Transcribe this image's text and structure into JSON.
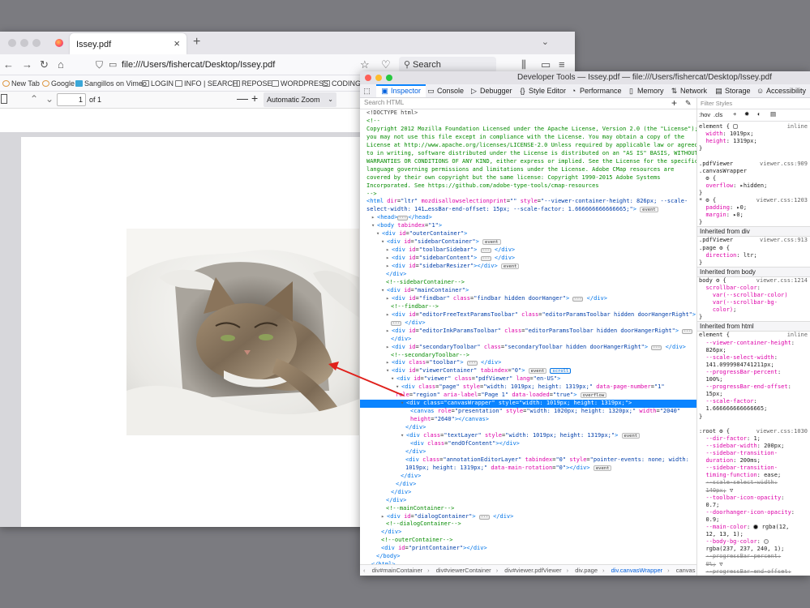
{
  "browser": {
    "tab_title": "Issey.pdf",
    "tab_close": "×",
    "new_tab": "+",
    "tab_menu": "⌄",
    "url": "file:///Users/fishercat/Desktop/Issey.pdf",
    "search_placeholder": "Search",
    "bookmarks": [
      "New Tab",
      "Google",
      "Sangillos on Vimeo",
      "LOGIN",
      "INFO | SEARCH",
      "REPOSE",
      "WORDPRESS",
      "CODING"
    ],
    "nav_icons": [
      "back-icon",
      "forward-icon",
      "reload-icon",
      "home-icon",
      "shield-icon",
      "star-icon",
      "pocket-icon",
      "library-icon",
      "reader-icon",
      "menu-icon"
    ]
  },
  "pdf_toolbar": {
    "page_value": "1",
    "of_label": "of 1",
    "zoom_label": "Automatic Zoom",
    "minus": "—",
    "plus": "+"
  },
  "devtools": {
    "title": "Developer Tools — Issey.pdf — file:///Users/fishercat/Desktop/Issey.pdf",
    "tabs": [
      "Inspector",
      "Console",
      "Debugger",
      "Style Editor",
      "Performance",
      "Memory",
      "Network",
      "Storage",
      "Accessibility"
    ],
    "active_tab": "Inspector",
    "search_placeholder": "Search HTML",
    "filter_placeholder": "Filter Styles",
    "rule_tools": [
      ":hov",
      ".cls",
      "+"
    ],
    "breadcrumbs": [
      "div#mainContainer",
      "div#viewerContainer",
      "div#viewer.pdfViewer",
      "div.page",
      "div.canvasWrapper",
      "canvas"
    ],
    "html_lines": [
      {
        "i": 0,
        "h": "<span class='p'>&lt;!DOCTYPE html&gt;</span>"
      },
      {
        "i": 0,
        "h": "<span class='c'>&lt;!--</span>"
      },
      {
        "i": 0,
        "h": "<span class='c'>Copyright 2012 Mozilla Foundation Licensed under the Apache License, Version 2.0 (the \"License\");</span>"
      },
      {
        "i": 0,
        "h": "<span class='c'>you may not use this file except in compliance with the License. You may obtain a copy of the</span>"
      },
      {
        "i": 0,
        "h": "<span class='c'>License at http://www.apache.org/licenses/LICENSE-2.0 Unless required by applicable law or agreed</span>"
      },
      {
        "i": 0,
        "h": "<span class='c'>to in writing, software distributed under the License is distributed on an \"AS IS\" BASIS, WITHOUT</span>"
      },
      {
        "i": 0,
        "h": "<span class='c'>WARRANTIES OR CONDITIONS OF ANY KIND, either express or implied. See the License for the specific</span>"
      },
      {
        "i": 0,
        "h": "<span class='c'>language governing permissions and limitations under the License. Adobe CMap resources are</span>"
      },
      {
        "i": 0,
        "h": "<span class='c'>covered by their own copyright but the same license: Copyright 1990-2015 Adobe Systems</span>"
      },
      {
        "i": 0,
        "h": "<span class='c'>Incorporated. See https://github.com/adobe-type-tools/cmap-resources</span>"
      },
      {
        "i": 0,
        "h": "<span class='c'>--&gt;</span>"
      },
      {
        "i": 0,
        "h": "<span class='t'>&lt;html</span> <span class='a'>dir</span>=<span class='v'>\"ltr\"</span> <span class='a'>mozdisallowselectionprint</span>=<span class='v'>\"\"</span> <span class='a'>style</span>=<span class='v'>\"--viewer-container-height: 826px; --scale-</span>"
      },
      {
        "i": 0,
        "h": "<span class='v'>select-width: 141…essBar-end-offset: 15px; --scale-factor: 1.666666666666665;\"</span><span class='t'>&gt;</span> <span class='badge'>event</span>"
      },
      {
        "i": 1,
        "h": "<span class='tw'>▸</span><span class='t'>&lt;head&gt;</span><span class='dots'>···</span><span class='t'>&lt;/head&gt;</span>"
      },
      {
        "i": 1,
        "h": "<span class='tw'>▾</span><span class='t'>&lt;body</span> <span class='a'>tabindex</span>=<span class='v'>\"1\"</span><span class='t'>&gt;</span>"
      },
      {
        "i": 2,
        "h": "<span class='tw'>▾</span><span class='t'>&lt;div</span> <span class='a'>id</span>=<span class='v'>\"outerContainer\"</span><span class='t'>&gt;</span>"
      },
      {
        "i": 3,
        "h": "<span class='tw'>▾</span><span class='t'>&lt;div</span> <span class='a'>id</span>=<span class='v'>\"sidebarContainer\"</span><span class='t'>&gt;</span> <span class='badge'>event</span>"
      },
      {
        "i": 4,
        "h": "<span class='tw'>▸</span><span class='t'>&lt;div</span> <span class='a'>id</span>=<span class='v'>\"toolbarSidebar\"</span><span class='t'>&gt;</span> <span class='dots'>···</span> <span class='t'>&lt;/div&gt;</span>"
      },
      {
        "i": 4,
        "h": "<span class='tw'>▸</span><span class='t'>&lt;div</span> <span class='a'>id</span>=<span class='v'>\"sidebarContent\"</span><span class='t'>&gt;</span> <span class='dots'>···</span> <span class='t'>&lt;/div&gt;</span>"
      },
      {
        "i": 4,
        "h": "<span class='tw'>▸</span><span class='t'>&lt;div</span> <span class='a'>id</span>=<span class='v'>\"sidebarResizer\"</span><span class='t'>&gt;&lt;/div&gt;</span> <span class='badge'>event</span>"
      },
      {
        "i": 4,
        "h": "<span class='t'>&lt;/div&gt;</span>"
      },
      {
        "i": 4,
        "h": "<span class='c'>&lt;!--sidebarContainer--&gt;</span>"
      },
      {
        "i": 3,
        "h": "<span class='tw'>▾</span><span class='t'>&lt;div</span> <span class='a'>id</span>=<span class='v'>\"mainContainer\"</span><span class='t'>&gt;</span>"
      },
      {
        "i": 4,
        "h": "<span class='tw'>▸</span><span class='t'>&lt;div</span> <span class='a'>id</span>=<span class='v'>\"findbar\"</span> <span class='a'>class</span>=<span class='v'>\"findbar hidden doorHanger\"</span><span class='t'>&gt;</span> <span class='dots'>···</span> <span class='t'>&lt;/div&gt;</span>"
      },
      {
        "i": 5,
        "h": "<span class='c'>&lt;!--findbar--&gt;</span>"
      },
      {
        "i": 4,
        "h": "<span class='tw'>▸</span><span class='t'>&lt;div</span> <span class='a'>id</span>=<span class='v'>\"editorFreeTextParamsToolbar\"</span> <span class='a'>class</span>=<span class='v'>\"editorParamsToolbar hidden doorHangerRight\"</span><span class='t'>&gt;</span>"
      },
      {
        "i": 5,
        "h": "<span class='dots'>···</span> <span class='t'>&lt;/div&gt;</span>"
      },
      {
        "i": 4,
        "h": "<span class='tw'>▸</span><span class='t'>&lt;div</span> <span class='a'>id</span>=<span class='v'>\"editorInkParamsToolbar\"</span> <span class='a'>class</span>=<span class='v'>\"editorParamsToolbar hidden doorHangerRight\"</span><span class='t'>&gt;</span> <span class='dots'>···</span>"
      },
      {
        "i": 5,
        "h": "<span class='t'>&lt;/div&gt;</span>"
      },
      {
        "i": 4,
        "h": "<span class='tw'>▸</span><span class='t'>&lt;div</span> <span class='a'>id</span>=<span class='v'>\"secondaryToolbar\"</span> <span class='a'>class</span>=<span class='v'>\"secondaryToolbar hidden doorHangerRight\"</span><span class='t'>&gt;</span> <span class='dots'>···</span> <span class='t'>&lt;/div&gt;</span>"
      },
      {
        "i": 5,
        "h": "<span class='c'>&lt;!--secondaryToolbar--&gt;</span>"
      },
      {
        "i": 4,
        "h": "<span class='tw'>▸</span><span class='t'>&lt;div</span> <span class='a'>class</span>=<span class='v'>\"toolbar\"</span><span class='t'>&gt;</span> <span class='dots'>···</span> <span class='t'>&lt;/div&gt;</span>"
      },
      {
        "i": 4,
        "h": "<span class='tw'>▾</span><span class='t'>&lt;div</span> <span class='a'>id</span>=<span class='v'>\"viewerContainer\"</span> <span class='a'>tabindex</span>=<span class='v'>\"0\"</span><span class='t'>&gt;</span> <span class='badge'>event</span> <span class='badge hl'>scroll</span>"
      },
      {
        "i": 5,
        "h": "<span class='tw'>▾</span><span class='t'>&lt;div</span> <span class='a'>id</span>=<span class='v'>\"viewer\"</span> <span class='a'>class</span>=<span class='v'>\"pdfViewer\"</span> <span class='a'>lang</span>=<span class='v'>\"en-US\"</span><span class='t'>&gt;</span>"
      },
      {
        "i": 6,
        "h": "<span class='tw'>▾</span><span class='t'>&lt;div</span> <span class='a'>class</span>=<span class='v'>\"page\"</span> <span class='a'>style</span>=<span class='v'>\"width: 1019px; height: 1319px;\"</span> <span class='a'>data-page-number</span>=<span class='v'>\"1\"</span>"
      },
      {
        "i": 6,
        "h": "<span class='a'>role</span>=<span class='v'>\"region\"</span> <span class='a'>aria-label</span>=<span class='v'>\"Page 1\"</span> <span class='a'>data-loaded</span>=<span class='v'>\"true\"</span><span class='t'>&gt;</span> <span class='badge'>overflow</span>"
      },
      {
        "i": 7,
        "sel": true,
        "h": "<span class='tw'>▾</span><span class='t'>&lt;div</span> <span class='a'>class</span>=<span class='v'>\"canvasWrapper\"</span> <span class='a'>style</span>=<span class='v'>\"width: 1019px; height: 1319px;\"</span><span class='t'>&gt;</span>"
      },
      {
        "i": 9,
        "h": "<span class='t'>&lt;canvas</span> <span class='a'>role</span>=<span class='v'>\"presentation\"</span> <span class='a'>style</span>=<span class='v'>\"width: 1020px; height: 1320px;\"</span> <span class='a'>width</span>=<span class='v'>\"2040\"</span>"
      },
      {
        "i": 9,
        "h": "<span class='a'>height</span>=<span class='v'>\"2640\"</span><span class='t'>&gt;&lt;/canvas&gt;</span>"
      },
      {
        "i": 8,
        "h": "<span class='t'>&lt;/div&gt;</span>"
      },
      {
        "i": 7,
        "h": "<span class='tw'>▾</span><span class='t'>&lt;div</span> <span class='a'>class</span>=<span class='v'>\"textLayer\"</span> <span class='a'>style</span>=<span class='v'>\"width: 1019px; height: 1319px;\"</span><span class='t'>&gt;</span> <span class='badge'>event</span>"
      },
      {
        "i": 9,
        "h": "<span class='t'>&lt;div</span> <span class='a'>class</span>=<span class='v'>\"endOfContent\"</span><span class='t'>&gt;&lt;/div&gt;</span>"
      },
      {
        "i": 8,
        "h": "<span class='t'>&lt;/div&gt;</span>"
      },
      {
        "i": 8,
        "h": "<span class='t'>&lt;div</span> <span class='a'>class</span>=<span class='v'>\"annotationEditorLayer\"</span> <span class='a'>tabindex</span>=<span class='v'>\"0\"</span> <span class='a'>style</span>=<span class='v'>\"pointer-events: none; width:</span>"
      },
      {
        "i": 8,
        "h": "<span class='v'>1019px; height: 1319px;\"</span> <span class='a'>data-main-rotation</span>=<span class='v'>\"0\"</span><span class='t'>&gt;&lt;/div&gt;</span> <span class='badge'>event</span>"
      },
      {
        "i": 7,
        "h": "<span class='t'>&lt;/div&gt;</span>"
      },
      {
        "i": 6,
        "h": "<span class='t'>&lt;/div&gt;</span>"
      },
      {
        "i": 5,
        "h": "<span class='t'>&lt;/div&gt;</span>"
      },
      {
        "i": 4,
        "h": "<span class='t'>&lt;/div&gt;</span>"
      },
      {
        "i": 4,
        "h": "<span class='c'>&lt;!--mainContainer--&gt;</span>"
      },
      {
        "i": 3,
        "h": "<span class='tw'>▸</span><span class='t'>&lt;div</span> <span class='a'>id</span>=<span class='v'>\"dialogContainer\"</span><span class='t'>&gt;</span> <span class='dots'>···</span> <span class='t'>&lt;/div&gt;</span>"
      },
      {
        "i": 4,
        "h": "<span class='c'>&lt;!--dialogContainer--&gt;</span>"
      },
      {
        "i": 3,
        "h": "<span class='t'>&lt;/div&gt;</span>"
      },
      {
        "i": 3,
        "h": "<span class='c'>&lt;!--outerContainer--&gt;</span>"
      },
      {
        "i": 3,
        "h": "<span class='t'>&lt;div</span> <span class='a'>id</span>=<span class='v'>\"printContainer\"</span><span class='t'>&gt;&lt;/div&gt;</span>"
      },
      {
        "i": 2,
        "h": "<span class='t'>&lt;/body&gt;</span>"
      },
      {
        "i": 1,
        "h": "<span class='t'>&lt;/html&gt;</span>"
      }
    ],
    "rule_lines": [
      {
        "k": "r",
        "h": "<span class='sel-txt'>element { </span><span class='swatch' style='border-radius:2px'></span><span class='src'>inline</span>"
      },
      {
        "k": "r",
        "h": "&nbsp;&nbsp;<span class='prop'>width</span>: <span class='val'>1019px;</span>"
      },
      {
        "k": "r",
        "h": "&nbsp;&nbsp;<span class='prop'>height</span>: <span class='val'>1319px;</span>"
      },
      {
        "k": "r",
        "h": "}"
      },
      {
        "k": "r",
        "h": ""
      },
      {
        "k": "r",
        "h": "<span class='sel-txt'>.pdfViewer</span><span class='src'>viewer.css:909</span>"
      },
      {
        "k": "r",
        "h": "<span class='sel-txt'>.canvasWrapper</span>"
      },
      {
        "k": "r",
        "h": "&nbsp;&nbsp;⚙ {"
      },
      {
        "k": "r",
        "h": "&nbsp;&nbsp;<span class='prop'>overflow</span>: ▸<span class='val'>hidden;</span>"
      },
      {
        "k": "r",
        "h": "}"
      },
      {
        "k": "r",
        "h": "<span class='sel-txt'>* ⚙ {</span><span class='src'>viewer.css:1203</span>"
      },
      {
        "k": "r",
        "h": "&nbsp;&nbsp;<span class='prop'>padding</span>: ▸<span class='val'>0;</span>"
      },
      {
        "k": "r",
        "h": "&nbsp;&nbsp;<span class='prop'>margin</span>: ▸<span class='val'>0;</span>"
      },
      {
        "k": "r",
        "h": "}"
      },
      {
        "k": "h",
        "h": "Inherited from div"
      },
      {
        "k": "r",
        "h": "<span class='sel-txt'>.pdfViewer</span><span class='src'>viewer.css:913</span>"
      },
      {
        "k": "r",
        "h": "<span class='sel-txt'>.page ⚙ {</span>"
      },
      {
        "k": "r",
        "h": "&nbsp;&nbsp;<span class='prop'>direction</span>: <span class='val'>ltr;</span>"
      },
      {
        "k": "r",
        "h": "}"
      },
      {
        "k": "h",
        "h": "Inherited from body"
      },
      {
        "k": "r",
        "h": "<span class='sel-txt'>body ⚙ {</span><span class='src'>viewer.css:1214</span>"
      },
      {
        "k": "r",
        "h": "&nbsp;&nbsp;<span class='prop'>scrollbar-color</span>:"
      },
      {
        "k": "r",
        "h": "&nbsp;&nbsp;&nbsp;&nbsp;<span class='prop'>var(--scrollbar-color)</span>"
      },
      {
        "k": "r",
        "h": "&nbsp;&nbsp;&nbsp;&nbsp;<span class='prop'>var(--scrollbar-bg-</span>"
      },
      {
        "k": "r",
        "h": "&nbsp;&nbsp;&nbsp;&nbsp;<span class='prop'>color)</span>;"
      },
      {
        "k": "r",
        "h": "}"
      },
      {
        "k": "h",
        "h": "Inherited from html"
      },
      {
        "k": "r",
        "h": "<span class='sel-txt'>element {</span><span class='src'>inline</span>"
      },
      {
        "k": "r",
        "h": "&nbsp;&nbsp;<span class='prop'>--viewer-container-height</span>:"
      },
      {
        "k": "r",
        "h": "&nbsp;&nbsp;<span class='val'>826px;</span>"
      },
      {
        "k": "r",
        "h": "&nbsp;&nbsp;<span class='prop'>--scale-select-width</span>:"
      },
      {
        "k": "r",
        "h": "&nbsp;&nbsp;<span class='val'>141.0999984741211px;</span>"
      },
      {
        "k": "r",
        "h": "&nbsp;&nbsp;<span class='prop'>--progressBar-percent</span>:"
      },
      {
        "k": "r",
        "h": "&nbsp;&nbsp;<span class='val'>100%;</span>"
      },
      {
        "k": "r",
        "h": "&nbsp;&nbsp;<span class='prop'>--progressBar-end-offset</span>:"
      },
      {
        "k": "r",
        "h": "&nbsp;&nbsp;<span class='val'>15px;</span>"
      },
      {
        "k": "r",
        "h": "&nbsp;&nbsp;<span class='prop'>--scale-factor</span>:"
      },
      {
        "k": "r",
        "h": "&nbsp;&nbsp;<span class='val'>1.666666666666665;</span>"
      },
      {
        "k": "r",
        "h": "}"
      },
      {
        "k": "r",
        "h": ""
      },
      {
        "k": "r",
        "h": "<span class='sel-txt'>:root ⚙ {</span><span class='src'>viewer.css:1030</span>"
      },
      {
        "k": "r",
        "h": "&nbsp;&nbsp;<span class='prop'>--dir-factor</span>: <span class='val'>1;</span>"
      },
      {
        "k": "r",
        "h": "&nbsp;&nbsp;<span class='prop'>--sidebar-width</span>: <span class='val'>200px;</span>"
      },
      {
        "k": "r",
        "h": "&nbsp;&nbsp;<span class='prop'>--sidebar-transition-</span>"
      },
      {
        "k": "r",
        "h": "&nbsp;&nbsp;<span class='prop'>duration</span>: <span class='val'>200ms;</span>"
      },
      {
        "k": "r",
        "h": "&nbsp;&nbsp;<span class='prop'>--sidebar-transition-</span>"
      },
      {
        "k": "r",
        "h": "&nbsp;&nbsp;<span class='prop'>timing-function</span>: <span class='val'>ease;</span>"
      },
      {
        "k": "r",
        "h": "&nbsp;&nbsp;<span class='strike'>--scale-select-width:</span>"
      },
      {
        "k": "r",
        "h": "&nbsp;&nbsp;<span class='strike'>140px;</span> ▽"
      },
      {
        "k": "r",
        "h": "&nbsp;&nbsp;<span class='prop'>--toolbar-icon-opacity</span>:"
      },
      {
        "k": "r",
        "h": "&nbsp;&nbsp;<span class='val'>0.7;</span>"
      },
      {
        "k": "r",
        "h": "&nbsp;&nbsp;<span class='prop'>--doorhanger-icon-opacity</span>:"
      },
      {
        "k": "r",
        "h": "&nbsp;&nbsp;<span class='val'>0.9;</span>"
      },
      {
        "k": "r",
        "h": "&nbsp;&nbsp;<span class='prop'>--main-color</span>: <span class='swatch' style='background:#0c0c0d'></span> <span class='val'>rgba(12,</span>"
      },
      {
        "k": "r",
        "h": "&nbsp;&nbsp;<span class='val'>12, 13, 1);</span>"
      },
      {
        "k": "r",
        "h": "&nbsp;&nbsp;<span class='prop'>--body-bg-color</span>: <span class='swatch' style='background:#ededf0'></span>"
      },
      {
        "k": "r",
        "h": "&nbsp;&nbsp;<span class='val'>rgba(237, 237, 240, 1);</span>"
      },
      {
        "k": "r",
        "h": "&nbsp;&nbsp;<span class='strike'>--progressBar-percent:</span>"
      },
      {
        "k": "r",
        "h": "&nbsp;&nbsp;<span class='strike'>0%;</span> ▽"
      },
      {
        "k": "r",
        "h": "&nbsp;&nbsp;<span class='strike'>--progressBar-end-offset:</span>"
      }
    ]
  },
  "colors": {
    "selection": "#0a84ff",
    "arrow": "#e0201b"
  }
}
